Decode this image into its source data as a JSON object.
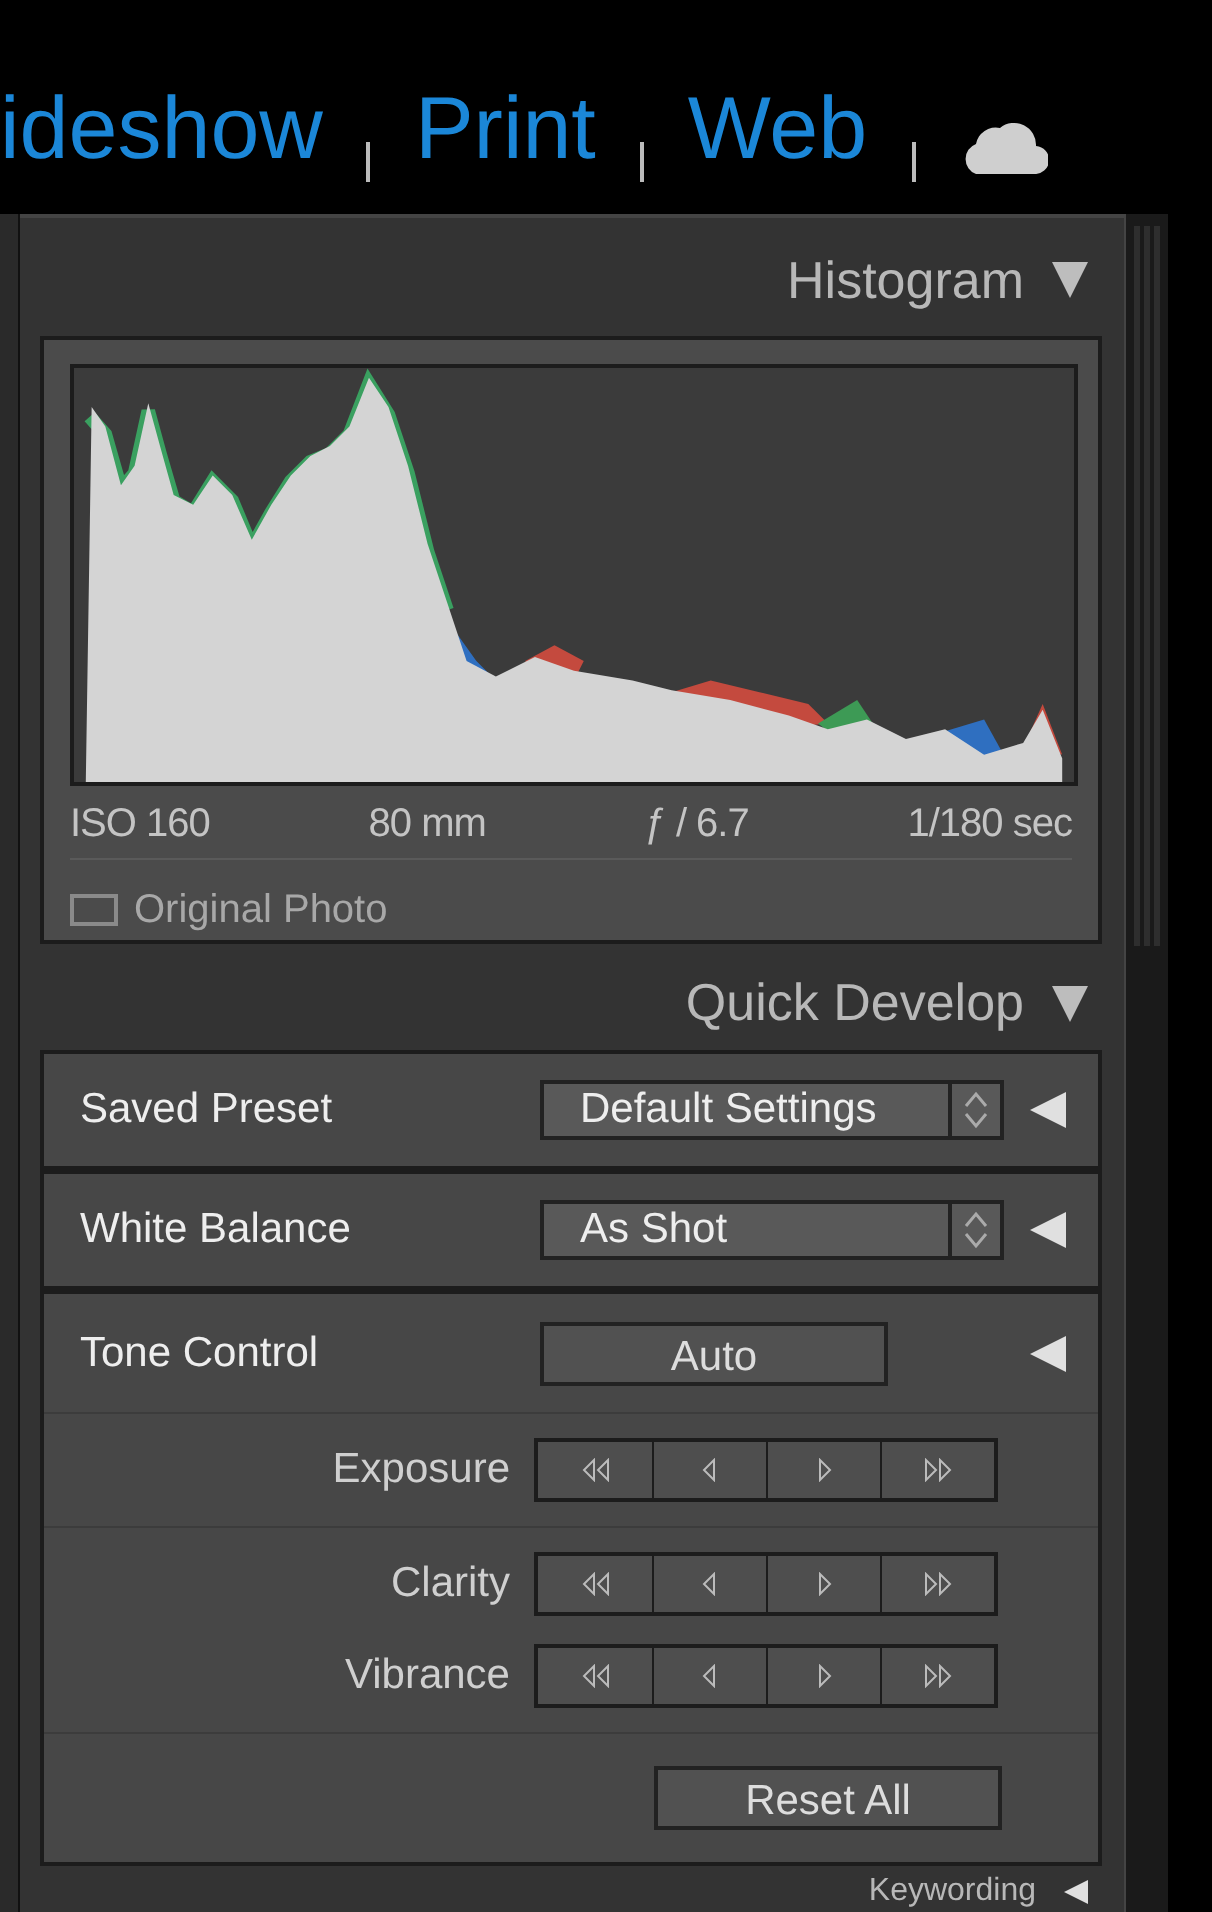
{
  "module_picker": {
    "modules": [
      {
        "label": "ideshow"
      },
      {
        "label": "Print"
      },
      {
        "label": "Web"
      }
    ]
  },
  "histogram": {
    "title": "Histogram",
    "expanded": true,
    "info": [
      "ISO 160",
      "80 mm",
      "ƒ / 6.7",
      "1/180 sec"
    ],
    "original_photo": {
      "label": "Original Photo",
      "checked": false
    }
  },
  "quick_develop": {
    "title": "Quick Develop",
    "expanded": true,
    "rows": [
      {
        "kind": "select",
        "label": "Saved Preset",
        "value": "Default Settings",
        "expanded": false
      },
      {
        "kind": "select",
        "label": "White Balance",
        "value": "As Shot",
        "expanded": false
      },
      {
        "kind": "button",
        "label": "Tone Control",
        "button": "Auto",
        "expanded": false
      }
    ],
    "adjust_groups": [
      {
        "items": [
          {
            "label": "Exposure"
          }
        ]
      },
      {
        "items": [
          {
            "label": "Clarity"
          },
          {
            "label": "Vibrance"
          }
        ]
      }
    ],
    "reset_button": "Reset All"
  },
  "keywording": {
    "title": "Keywording",
    "expanded": false
  }
}
